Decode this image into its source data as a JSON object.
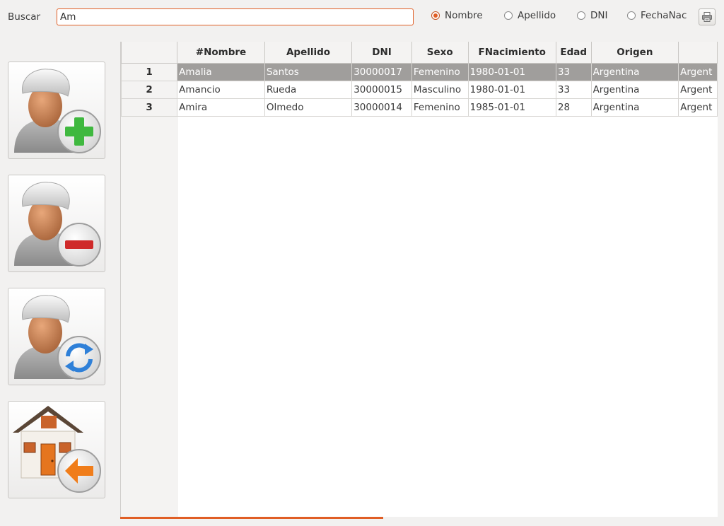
{
  "search": {
    "label": "Buscar",
    "value": "Am"
  },
  "filter_options": [
    {
      "label": "Nombre",
      "checked": true
    },
    {
      "label": "Apellido",
      "checked": false
    },
    {
      "label": "DNI",
      "checked": false
    },
    {
      "label": "FechaNac",
      "checked": false
    }
  ],
  "print_icon": "printer-icon",
  "side_buttons": [
    {
      "name": "add-user-button",
      "icon": "user-add-icon"
    },
    {
      "name": "remove-user-button",
      "icon": "user-remove-icon"
    },
    {
      "name": "refresh-user-button",
      "icon": "user-refresh-icon"
    },
    {
      "name": "home-button",
      "icon": "home-back-icon"
    }
  ],
  "table": {
    "columns": [
      "",
      "#Nombre",
      "Apellido",
      "DNI",
      "Sexo",
      "FNacimiento",
      "Edad",
      "Origen",
      ""
    ],
    "rows": [
      {
        "num": "1",
        "cells": [
          "Amalia",
          "Santos",
          "30000017",
          "Femenino",
          "1980-01-01",
          "33",
          "Argentina",
          "Argent"
        ],
        "selected": true
      },
      {
        "num": "2",
        "cells": [
          "Amancio",
          "Rueda",
          "30000015",
          "Masculino",
          "1980-01-01",
          "33",
          "Argentina",
          "Argent"
        ],
        "selected": false
      },
      {
        "num": "3",
        "cells": [
          "Amira",
          "Olmedo",
          "30000014",
          "Femenino",
          "1985-01-01",
          "28",
          "Argentina",
          "Argent"
        ],
        "selected": false
      }
    ]
  },
  "colors": {
    "accent": "#e05e25",
    "selected_row": "#a09e9c"
  }
}
